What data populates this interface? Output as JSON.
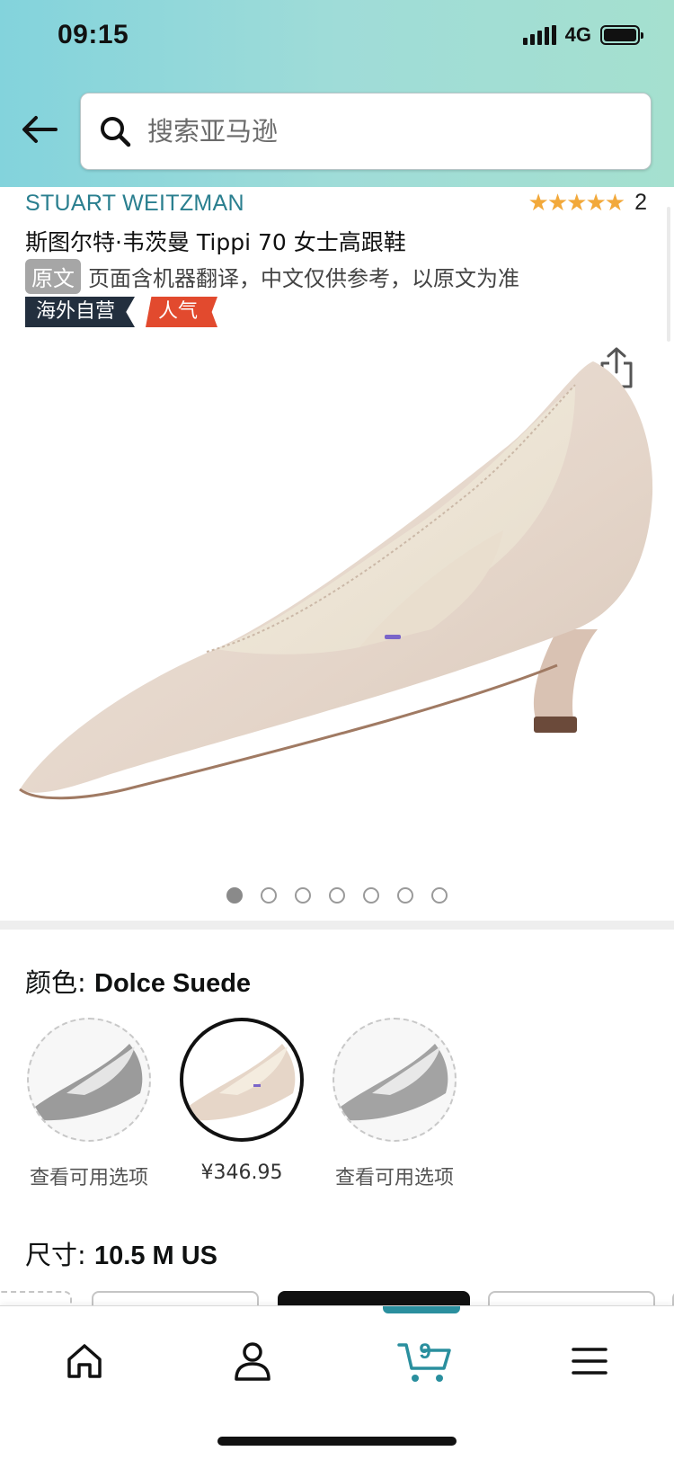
{
  "status_bar": {
    "time": "09:15",
    "network": "4G"
  },
  "search": {
    "placeholder": "搜索亚马逊"
  },
  "product": {
    "brand": "STUART WEITZMAN",
    "rating_stars": 5,
    "rating_count": "2",
    "title": "斯图尔特·韦茨曼 Tippi 70 女士高跟鞋",
    "original_tag": "原文",
    "translation_note": "页面含机器翻译，中文仅供参考，以原文为准",
    "badges": [
      "海外自营",
      "人气"
    ],
    "image_count": 7,
    "active_image_index": 0
  },
  "color": {
    "label": "颜色: ",
    "selected": "Dolce Suede",
    "options": [
      {
        "label": "查看可用选项",
        "selected": false
      },
      {
        "label": "¥346.95",
        "selected": true
      },
      {
        "label": "查看可用选项",
        "selected": false
      }
    ]
  },
  "size": {
    "label": "尺寸: ",
    "selected": "10.5 M US"
  },
  "bottom_nav": {
    "items": [
      "home-icon",
      "account-icon",
      "cart-icon",
      "menu-icon"
    ],
    "cart_count": "9"
  },
  "colors": {
    "header_gradient_start": "#83d3dc",
    "header_gradient_end": "#a5e0cf",
    "brand_link": "#2a7f8f",
    "star": "#f2a93b",
    "badge_dark": "#232f3e",
    "badge_hot": "#e24a2e",
    "cart_accent": "#2a8f9e"
  }
}
